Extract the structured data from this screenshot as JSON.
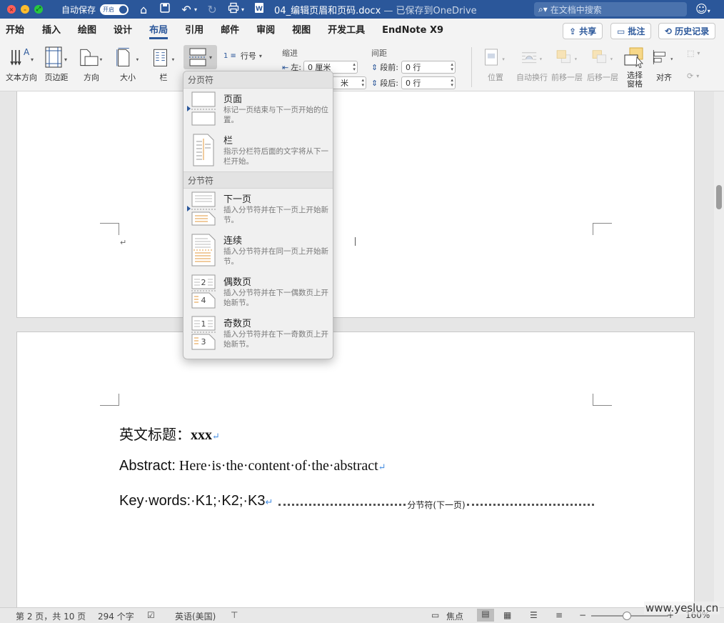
{
  "titlebar": {
    "autosave_label": "自动保存",
    "autosave_toggle": "开启",
    "doc_name": "04_编辑页眉和页码.docx",
    "saved_status": "— 已保存到OneDrive",
    "search_placeholder": "在文档中搜索"
  },
  "tabs": [
    {
      "label": "开始"
    },
    {
      "label": "插入"
    },
    {
      "label": "绘图"
    },
    {
      "label": "设计"
    },
    {
      "label": "布局",
      "active": true
    },
    {
      "label": "引用"
    },
    {
      "label": "邮件"
    },
    {
      "label": "审阅"
    },
    {
      "label": "视图"
    },
    {
      "label": "开发工具"
    },
    {
      "label": "EndNote X9"
    }
  ],
  "tab_actions": {
    "share": "共享",
    "comments": "批注",
    "history": "历史记录"
  },
  "ribbon": {
    "text_direction": "文本方向",
    "margins": "页边距",
    "orientation": "方向",
    "size": "大小",
    "columns": "栏",
    "line_numbers": "行号",
    "indent_header": "缩进",
    "indent_left_label": "左:",
    "indent_left_value": "0 厘米",
    "indent_right_value": "米",
    "spacing_header": "间距",
    "spacing_before_label": "段前:",
    "spacing_before_value": "0 行",
    "spacing_after_label": "段后:",
    "spacing_after_value": "0 行",
    "position": "位置",
    "wrap_text": "自动换行",
    "bring_forward": "前移一层",
    "send_backward": "后移一层",
    "selection_pane_1": "选择",
    "selection_pane_2": "窗格",
    "align": "对齐"
  },
  "breaks_menu": {
    "page_breaks_header": "分页符",
    "section_breaks_header": "分节符",
    "items": [
      {
        "title": "页面",
        "desc": "标记一页结束与下一页开始的位置。"
      },
      {
        "title": "栏",
        "desc": "指示分栏符后面的文字将从下一栏开始。"
      },
      {
        "title": "下一页",
        "desc": "插入分节符并在下一页上开始新节。"
      },
      {
        "title": "连续",
        "desc": "插入分节符并在同一页上开始新节。"
      },
      {
        "title": "偶数页",
        "desc": "插入分节符并在下一偶数页上开始新节。"
      },
      {
        "title": "奇数页",
        "desc": "插入分节符并在下一奇数页上开始新节。"
      }
    ]
  },
  "document": {
    "title_cn": "英文标题：",
    "title_en": "xxx",
    "abstract_label": "Abstract:",
    "abstract_text": "Here·is·the·content·of·the·abstract",
    "keywords": "Key·words:·K1;·K2;·K3",
    "section_break_label": "分节符(下一页)"
  },
  "statusbar": {
    "page": "第 2 页，共 10 页",
    "words": "294 个字",
    "language": "英语(美国)",
    "focus": "焦点",
    "zoom": "160%",
    "zoom_level_fraction": 0.46
  },
  "watermark": "www.yeslu.cn"
}
